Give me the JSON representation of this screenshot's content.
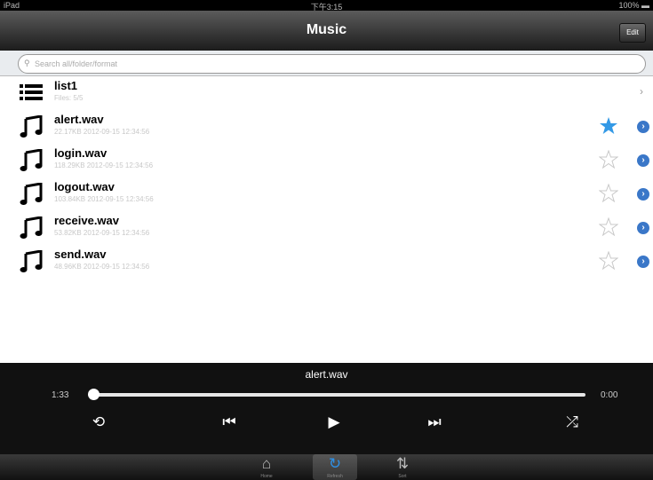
{
  "status": {
    "device": "iPad",
    "time": "下午3:15",
    "battery": "100%"
  },
  "navbar": {
    "title": "Music",
    "edit_label": "Edit"
  },
  "search": {
    "placeholder": "Search all/folder/format"
  },
  "list": [
    {
      "kind": "playlist",
      "name": "list1",
      "sub": "Files: 5/5"
    },
    {
      "kind": "song",
      "name": "alert.wav",
      "sub": "22.17KB  2012-09-15 12:34:56",
      "favorite": true
    },
    {
      "kind": "song",
      "name": "login.wav",
      "sub": "118.29KB  2012-09-15 12:34:56",
      "favorite": false
    },
    {
      "kind": "song",
      "name": "logout.wav",
      "sub": "103.84KB  2012-09-15 12:34:56",
      "favorite": false
    },
    {
      "kind": "song",
      "name": "receive.wav",
      "sub": "53.82KB  2012-09-15 12:34:56",
      "favorite": false
    },
    {
      "kind": "song",
      "name": "send.wav",
      "sub": "48.96KB  2012-09-15 12:34:56",
      "favorite": false
    }
  ],
  "player": {
    "track": "alert.wav",
    "elapsed": "1:33",
    "remaining": "0:00",
    "progress": 0.0,
    "controls": {
      "repeat": "⟲",
      "prev": "⏮",
      "play": "▶",
      "next": "⏭",
      "shuffle": "⤮"
    }
  },
  "tabs": [
    {
      "name": "tab-home",
      "icon": "home-icon",
      "label": "Home",
      "active": false
    },
    {
      "name": "tab-refresh",
      "icon": "refresh-icon",
      "label": "Refresh",
      "active": true
    },
    {
      "name": "tab-sort",
      "icon": "sort-icon",
      "label": "Sort",
      "active": false
    }
  ],
  "colors": {
    "accent": "#2e90e6",
    "disclosure": "#3a77c8",
    "star_on": "#3399e6",
    "star_off": "#c8c8c8"
  }
}
